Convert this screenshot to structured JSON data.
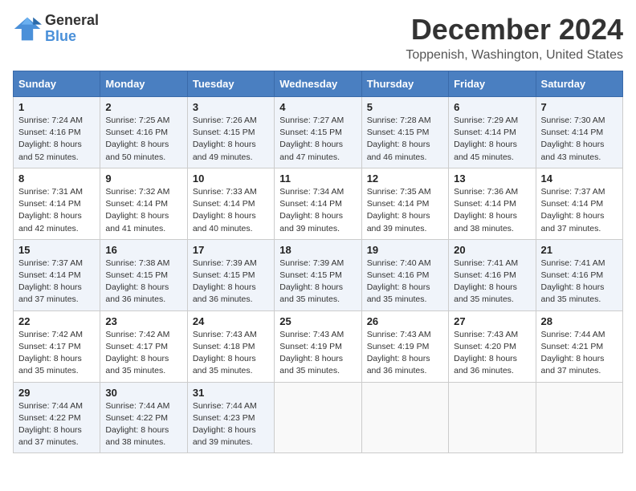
{
  "logo": {
    "line1": "General",
    "line2": "Blue"
  },
  "title": "December 2024",
  "subtitle": "Toppenish, Washington, United States",
  "headers": [
    "Sunday",
    "Monday",
    "Tuesday",
    "Wednesday",
    "Thursday",
    "Friday",
    "Saturday"
  ],
  "weeks": [
    [
      {
        "day": "1",
        "sunrise": "Sunrise: 7:24 AM",
        "sunset": "Sunset: 4:16 PM",
        "daylight": "Daylight: 8 hours and 52 minutes."
      },
      {
        "day": "2",
        "sunrise": "Sunrise: 7:25 AM",
        "sunset": "Sunset: 4:16 PM",
        "daylight": "Daylight: 8 hours and 50 minutes."
      },
      {
        "day": "3",
        "sunrise": "Sunrise: 7:26 AM",
        "sunset": "Sunset: 4:15 PM",
        "daylight": "Daylight: 8 hours and 49 minutes."
      },
      {
        "day": "4",
        "sunrise": "Sunrise: 7:27 AM",
        "sunset": "Sunset: 4:15 PM",
        "daylight": "Daylight: 8 hours and 47 minutes."
      },
      {
        "day": "5",
        "sunrise": "Sunrise: 7:28 AM",
        "sunset": "Sunset: 4:15 PM",
        "daylight": "Daylight: 8 hours and 46 minutes."
      },
      {
        "day": "6",
        "sunrise": "Sunrise: 7:29 AM",
        "sunset": "Sunset: 4:14 PM",
        "daylight": "Daylight: 8 hours and 45 minutes."
      },
      {
        "day": "7",
        "sunrise": "Sunrise: 7:30 AM",
        "sunset": "Sunset: 4:14 PM",
        "daylight": "Daylight: 8 hours and 43 minutes."
      }
    ],
    [
      {
        "day": "8",
        "sunrise": "Sunrise: 7:31 AM",
        "sunset": "Sunset: 4:14 PM",
        "daylight": "Daylight: 8 hours and 42 minutes."
      },
      {
        "day": "9",
        "sunrise": "Sunrise: 7:32 AM",
        "sunset": "Sunset: 4:14 PM",
        "daylight": "Daylight: 8 hours and 41 minutes."
      },
      {
        "day": "10",
        "sunrise": "Sunrise: 7:33 AM",
        "sunset": "Sunset: 4:14 PM",
        "daylight": "Daylight: 8 hours and 40 minutes."
      },
      {
        "day": "11",
        "sunrise": "Sunrise: 7:34 AM",
        "sunset": "Sunset: 4:14 PM",
        "daylight": "Daylight: 8 hours and 39 minutes."
      },
      {
        "day": "12",
        "sunrise": "Sunrise: 7:35 AM",
        "sunset": "Sunset: 4:14 PM",
        "daylight": "Daylight: 8 hours and 39 minutes."
      },
      {
        "day": "13",
        "sunrise": "Sunrise: 7:36 AM",
        "sunset": "Sunset: 4:14 PM",
        "daylight": "Daylight: 8 hours and 38 minutes."
      },
      {
        "day": "14",
        "sunrise": "Sunrise: 7:37 AM",
        "sunset": "Sunset: 4:14 PM",
        "daylight": "Daylight: 8 hours and 37 minutes."
      }
    ],
    [
      {
        "day": "15",
        "sunrise": "Sunrise: 7:37 AM",
        "sunset": "Sunset: 4:14 PM",
        "daylight": "Daylight: 8 hours and 37 minutes."
      },
      {
        "day": "16",
        "sunrise": "Sunrise: 7:38 AM",
        "sunset": "Sunset: 4:15 PM",
        "daylight": "Daylight: 8 hours and 36 minutes."
      },
      {
        "day": "17",
        "sunrise": "Sunrise: 7:39 AM",
        "sunset": "Sunset: 4:15 PM",
        "daylight": "Daylight: 8 hours and 36 minutes."
      },
      {
        "day": "18",
        "sunrise": "Sunrise: 7:39 AM",
        "sunset": "Sunset: 4:15 PM",
        "daylight": "Daylight: 8 hours and 35 minutes."
      },
      {
        "day": "19",
        "sunrise": "Sunrise: 7:40 AM",
        "sunset": "Sunset: 4:16 PM",
        "daylight": "Daylight: 8 hours and 35 minutes."
      },
      {
        "day": "20",
        "sunrise": "Sunrise: 7:41 AM",
        "sunset": "Sunset: 4:16 PM",
        "daylight": "Daylight: 8 hours and 35 minutes."
      },
      {
        "day": "21",
        "sunrise": "Sunrise: 7:41 AM",
        "sunset": "Sunset: 4:16 PM",
        "daylight": "Daylight: 8 hours and 35 minutes."
      }
    ],
    [
      {
        "day": "22",
        "sunrise": "Sunrise: 7:42 AM",
        "sunset": "Sunset: 4:17 PM",
        "daylight": "Daylight: 8 hours and 35 minutes."
      },
      {
        "day": "23",
        "sunrise": "Sunrise: 7:42 AM",
        "sunset": "Sunset: 4:17 PM",
        "daylight": "Daylight: 8 hours and 35 minutes."
      },
      {
        "day": "24",
        "sunrise": "Sunrise: 7:43 AM",
        "sunset": "Sunset: 4:18 PM",
        "daylight": "Daylight: 8 hours and 35 minutes."
      },
      {
        "day": "25",
        "sunrise": "Sunrise: 7:43 AM",
        "sunset": "Sunset: 4:19 PM",
        "daylight": "Daylight: 8 hours and 35 minutes."
      },
      {
        "day": "26",
        "sunrise": "Sunrise: 7:43 AM",
        "sunset": "Sunset: 4:19 PM",
        "daylight": "Daylight: 8 hours and 36 minutes."
      },
      {
        "day": "27",
        "sunrise": "Sunrise: 7:43 AM",
        "sunset": "Sunset: 4:20 PM",
        "daylight": "Daylight: 8 hours and 36 minutes."
      },
      {
        "day": "28",
        "sunrise": "Sunrise: 7:44 AM",
        "sunset": "Sunset: 4:21 PM",
        "daylight": "Daylight: 8 hours and 37 minutes."
      }
    ],
    [
      {
        "day": "29",
        "sunrise": "Sunrise: 7:44 AM",
        "sunset": "Sunset: 4:22 PM",
        "daylight": "Daylight: 8 hours and 37 minutes."
      },
      {
        "day": "30",
        "sunrise": "Sunrise: 7:44 AM",
        "sunset": "Sunset: 4:22 PM",
        "daylight": "Daylight: 8 hours and 38 minutes."
      },
      {
        "day": "31",
        "sunrise": "Sunrise: 7:44 AM",
        "sunset": "Sunset: 4:23 PM",
        "daylight": "Daylight: 8 hours and 39 minutes."
      },
      null,
      null,
      null,
      null
    ]
  ]
}
